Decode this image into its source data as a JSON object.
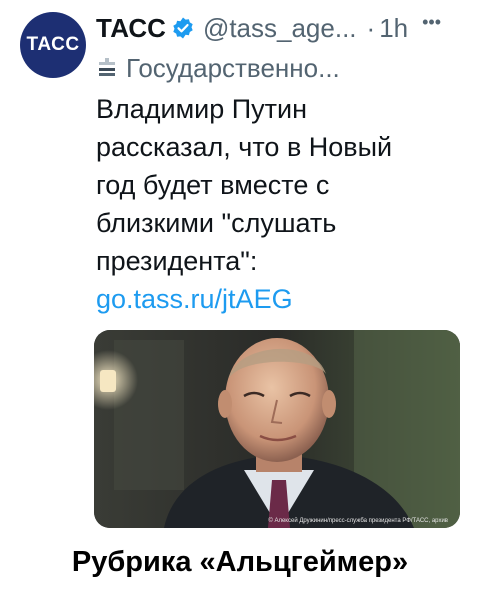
{
  "tweet": {
    "avatar_text": "ТАСС",
    "display_name": "ТАСС",
    "handle": "@tass_age...",
    "separator": "·",
    "time": "1h",
    "more_icon": "ellipsis-icon",
    "affiliation": "Государственно...",
    "text_lines": [
      "Владимир Путин",
      "рассказал, что в Новый",
      "год будет вместе с",
      "близкими \"слушать",
      "президента\":"
    ],
    "link": "go.tass.ru/jtAEG",
    "photo_credit": "© Алексей Дружинин/пресс-служба президента РФ/ТАСС, архив"
  },
  "caption": "Рубрика «Альцгеймер»",
  "colors": {
    "avatar_bg": "#1d2f73",
    "verified_blue": "#1d9bf0",
    "link_blue": "#1d9bf0",
    "secondary_text": "#536471"
  }
}
